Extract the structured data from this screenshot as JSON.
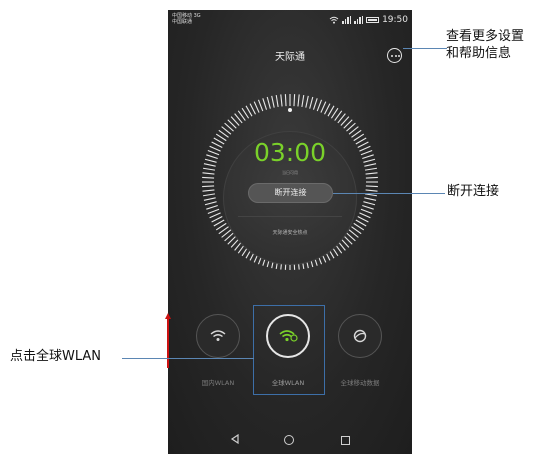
{
  "status_bar": {
    "carrier_1": "中国移动 3G",
    "carrier_2": "中国联通",
    "time": "19:50"
  },
  "app": {
    "title": "天际通",
    "timer": "03:00",
    "timer_sub": "当日可用",
    "disconnect_label": "断开连接",
    "hotspot_label": "天际通安全热点"
  },
  "options": [
    {
      "label": "国内WLAN",
      "icon": "wifi-icon"
    },
    {
      "label": "全球WLAN",
      "icon": "global-wifi-icon",
      "selected": true
    },
    {
      "label": "全球移动数据",
      "icon": "globe-icon"
    }
  ],
  "callouts": {
    "more_info_line1": "查看更多设置",
    "more_info_line2": "和帮助信息",
    "disconnect": "断开连接",
    "global_wlan": "点击全球WLAN"
  },
  "colors": {
    "accent_green": "#7ad12a",
    "highlight_blue": "#3d6fa8",
    "arrow_red": "#cc1111"
  }
}
